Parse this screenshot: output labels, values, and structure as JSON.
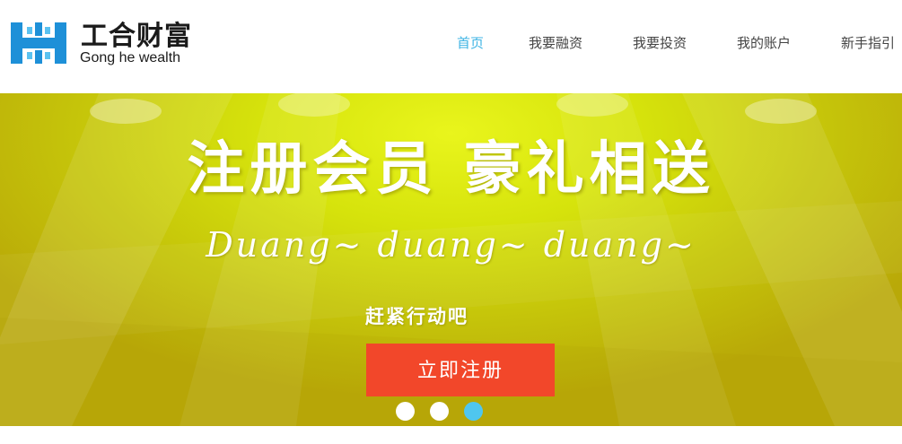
{
  "logo": {
    "title_cn": "工合财富",
    "title_en": "Gong he wealth",
    "icon": "hh-logo-icon",
    "colors": {
      "mark_blue": "#1e90d8",
      "mark_light": "#5bc2f0"
    }
  },
  "nav": {
    "items": [
      {
        "label": "首页",
        "active": true
      },
      {
        "label": "我要融资",
        "active": false
      },
      {
        "label": "我要投资",
        "active": false
      },
      {
        "label": "我的账户",
        "active": false
      },
      {
        "label": "新手指引",
        "active": false
      }
    ],
    "active_color": "#3fb4e4"
  },
  "banner": {
    "headline": "注册会员  豪礼相送",
    "subline": "Duang~ duang~ duang~",
    "cta_text": "赶紧行动吧",
    "button_label": "立即注册",
    "button_color": "#f2472a",
    "slides": [
      {
        "active": false
      },
      {
        "active": false
      },
      {
        "active": true
      }
    ],
    "dot_active_color": "#4fc6ef"
  }
}
